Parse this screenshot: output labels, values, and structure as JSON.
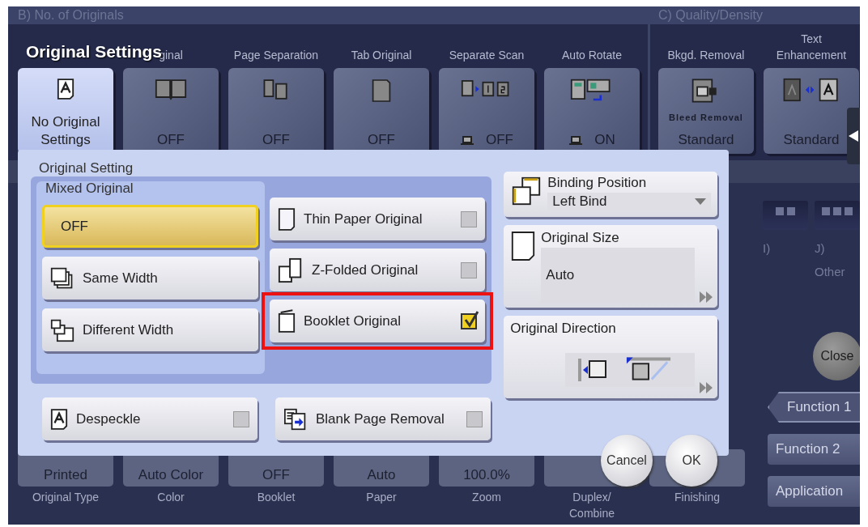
{
  "title": "Original Settings",
  "top_groups": [
    {
      "title": "B)  No. of Originals",
      "tiles": [
        {
          "value": "No Original Settings",
          "selected": true,
          "platen": false
        },
        {
          "label": "ginal",
          "value": "OFF",
          "selected": false,
          "platen": false
        },
        {
          "label": "Page Separation",
          "value": "OFF",
          "selected": false,
          "platen": false
        },
        {
          "label": "Tab Original",
          "value": "OFF",
          "selected": false,
          "platen": false
        },
        {
          "label": "Separate Scan",
          "value": "OFF",
          "selected": false,
          "platen": true
        },
        {
          "label": "Auto Rotate",
          "value": "ON",
          "selected": false,
          "platen": true
        }
      ]
    },
    {
      "title": "C)  Quality/Density",
      "tiles": [
        {
          "label": "Bkgd. Removal",
          "caption": "Bleed Removal",
          "value": "Standard",
          "selected": false,
          "platen": false
        },
        {
          "label": "Text Enhancement",
          "value": "Standard",
          "selected": false,
          "platen": false
        }
      ]
    }
  ],
  "side_tiles": [
    {
      "label": "I)"
    },
    {
      "label": "J)",
      "caption": "Other"
    }
  ],
  "close": "Close",
  "functions": [
    {
      "label": "Function 1",
      "selected": true
    },
    {
      "label": "Function 2",
      "selected": false
    },
    {
      "label": "Application",
      "selected": false
    }
  ],
  "bottom_tiles": [
    {
      "value": "Printed",
      "label": "Original Type"
    },
    {
      "value": "Auto Color",
      "label": "Color"
    },
    {
      "value": "OFF",
      "label": "Booklet"
    },
    {
      "value": "Auto",
      "label": "Paper"
    },
    {
      "value": "100.0%",
      "label": "Zoom"
    },
    {
      "label": "Duplex/ Combine"
    },
    {
      "label": "Finishing"
    }
  ],
  "dialog": {
    "group_title": "Original Setting",
    "mixed": {
      "title": "Mixed Original",
      "options": [
        {
          "label": "OFF",
          "selected": true
        },
        {
          "label": "Same Width",
          "selected": false
        },
        {
          "label": "Different Width",
          "selected": false
        }
      ]
    },
    "options": [
      {
        "label": "Thin Paper Original",
        "checked": false,
        "highlighted": false
      },
      {
        "label": "Z-Folded Original",
        "checked": false,
        "highlighted": false
      },
      {
        "label": "Booklet Original",
        "checked": true,
        "highlighted": true
      }
    ],
    "bottom_options": [
      {
        "label": "Despeckle",
        "checked": false
      },
      {
        "label": "Blank Page Removal",
        "checked": false
      }
    ],
    "binding": {
      "label": "Binding Position",
      "value": "Left Bind"
    },
    "size": {
      "label": "Original Size",
      "value": "Auto"
    },
    "direction": {
      "label": "Original Direction"
    },
    "buttons": [
      {
        "label": "Cancel"
      },
      {
        "label": "OK"
      }
    ]
  }
}
